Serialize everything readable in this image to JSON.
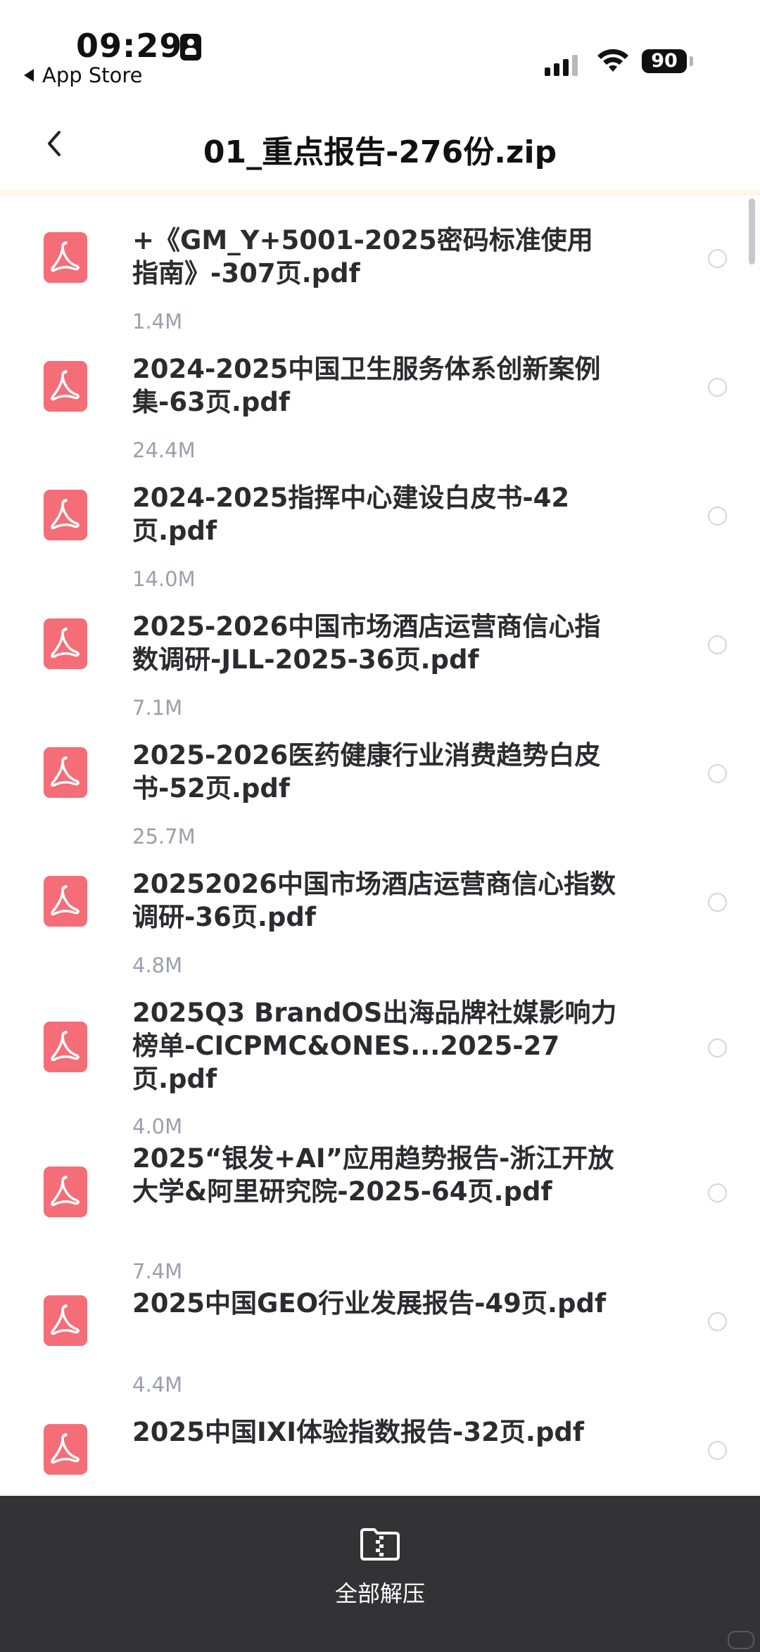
{
  "status_bar": {
    "time": "09:29",
    "back_app_label": "App Store",
    "battery": "90"
  },
  "header": {
    "title": "01_重点报告-276份.zip"
  },
  "files": [
    {
      "name": "+《GM_Y+5001-2025密码标准使用指南》-307页.pdf",
      "size": "1.4M"
    },
    {
      "name": "2024-2025中国卫生服务体系创新案例集-63页.pdf",
      "size": "24.4M"
    },
    {
      "name": "2024-2025指挥中心建设白皮书-42页.pdf",
      "size": "14.0M"
    },
    {
      "name": "2025-2026中国市场酒店运营商信心指数调研-JLL-2025-36页.pdf",
      "size": "7.1M"
    },
    {
      "name": "2025-2026医药健康行业消费趋势白皮书-52页.pdf",
      "size": "25.7M"
    },
    {
      "name": "20252026中国市场酒店运营商信心指数调研-36页.pdf",
      "size": "4.8M"
    },
    {
      "name": "2025Q3 BrandOS出海品牌社媒影响力榜单-CICPMC&ONES...2025-27页.pdf",
      "size": "4.0M"
    },
    {
      "name": "2025“银发+AI”应用趋势报告-浙江开放大学&阿里研究院-2025-64页.pdf",
      "size": "7.4M"
    },
    {
      "name": "2025中国GEO行业发展报告-49页.pdf",
      "size": "4.4M"
    },
    {
      "name": "2025中国IXI体验指数报告-32页.pdf",
      "size": ""
    }
  ],
  "bottom_bar": {
    "extract_all_label": "全部解压"
  },
  "colors": {
    "pdf_icon": "#f46d77",
    "bottom_bar": "#333336",
    "size_text": "#9aa0ad"
  }
}
